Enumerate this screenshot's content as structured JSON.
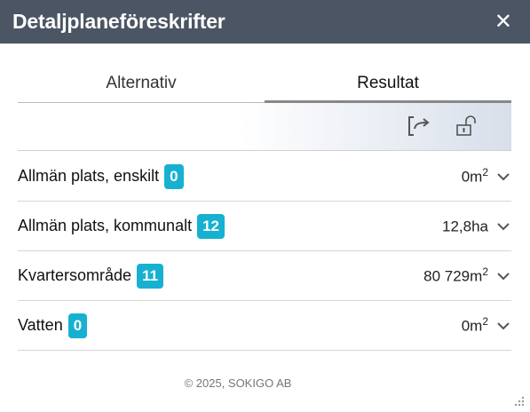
{
  "window": {
    "title": "Detaljplaneföreskrifter",
    "close_label": "✕"
  },
  "tabs": [
    {
      "label": "Alternativ",
      "active": false
    },
    {
      "label": "Resultat",
      "active": true
    }
  ],
  "toolbar": {
    "icons": [
      "export-icon",
      "unlock-icon"
    ]
  },
  "rows": [
    {
      "label": "Allmän plats, enskilt",
      "count": "0",
      "value": "0m",
      "unit_sup": "2"
    },
    {
      "label": "Allmän plats, kommunalt",
      "count": "12",
      "value": "12,8ha",
      "unit_sup": ""
    },
    {
      "label": "Kvartersområde",
      "count": "11",
      "value": "80 729m",
      "unit_sup": "2"
    },
    {
      "label": "Vatten",
      "count": "0",
      "value": "0m",
      "unit_sup": "2"
    }
  ],
  "footer": {
    "copyright": "© 2025, SOKIGO AB"
  },
  "colors": {
    "titlebar": "#4b5563",
    "badge": "#16b1d1"
  }
}
